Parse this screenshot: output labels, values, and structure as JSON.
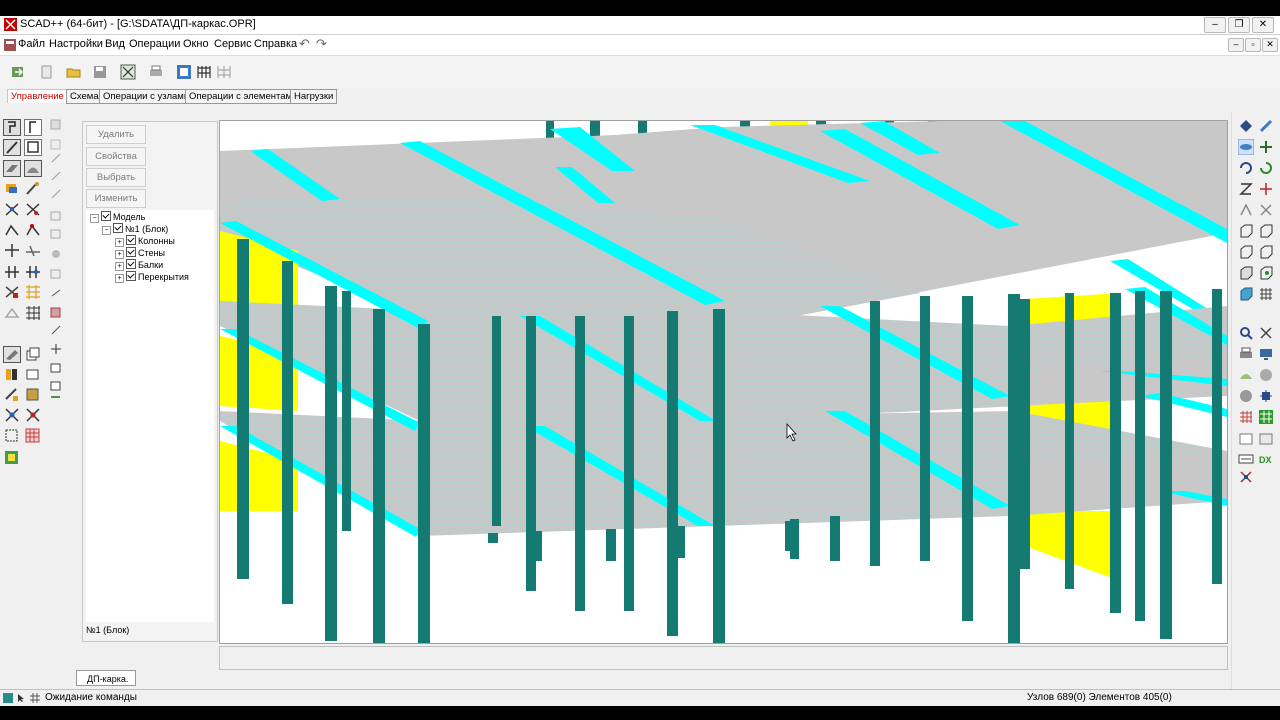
{
  "window": {
    "title": "SCAD++ (64-бит) - [G:\\SDATA\\ДП-каркас.OPR]",
    "controls": {
      "minimize": "–",
      "restore": "❐",
      "close": "✕"
    },
    "mdi_controls": {
      "minimize": "–",
      "restore": "▫",
      "close": "✕"
    }
  },
  "menu": {
    "items": [
      "Файл",
      "Настройки",
      "Вид",
      "Операции",
      "Окно",
      "Сервис",
      "Справка"
    ],
    "undo_glyph": "↶",
    "redo_glyph": "↷"
  },
  "tabs": [
    {
      "label": "Управление",
      "active": true
    },
    {
      "label": "Схема",
      "active": false
    },
    {
      "label": "Операции с узлами",
      "active": false
    },
    {
      "label": "Операции с элементами",
      "active": false
    },
    {
      "label": "Нагрузки",
      "active": false
    }
  ],
  "panel": {
    "buttons": [
      "Удалить",
      "Свойства",
      "Выбрать",
      "Изменить"
    ],
    "tree": [
      {
        "label": "Модель",
        "level": 0,
        "expanded": true
      },
      {
        "label": "№1 (Блок)",
        "level": 1,
        "expanded": true
      },
      {
        "label": "Колонны",
        "level": 2,
        "expanded": false
      },
      {
        "label": "Стены",
        "level": 2,
        "expanded": false
      },
      {
        "label": "Балки",
        "level": 2,
        "expanded": false
      },
      {
        "label": "Перекрытия",
        "level": 2,
        "expanded": false
      }
    ],
    "footer": "№1 (Блок)"
  },
  "document_tab": "ДП-карка.",
  "status": {
    "message": "Ожидание команды",
    "counts": "Узлов 689(0) Элементов 405(0)"
  },
  "colors": {
    "column": "#147a72",
    "beam": "#00ffff",
    "slab": "#c8c8c8",
    "wall": "#ffff00",
    "active_tab_text": "#c00000"
  }
}
